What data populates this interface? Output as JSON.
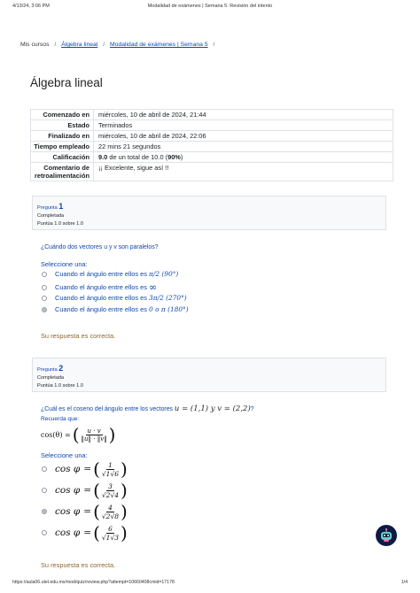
{
  "print_header": {
    "timestamp": "4/13/24, 3:06 PM",
    "title": "Modalidad de exámenes | Semana 5: Revisión del intento"
  },
  "breadcrumb": {
    "home": "Mis cursos",
    "course": "Álgebra lineal",
    "quiz": "Modalidad de exámenes | Semana 5",
    "sep": "/"
  },
  "page_title": "Álgebra lineal",
  "summary": [
    {
      "label": "Comenzado en",
      "value": "miércoles, 10 de abril de 2024, 21:44"
    },
    {
      "label": "Estado",
      "value": "Terminados"
    },
    {
      "label": "Finalizado en",
      "value": "miércoles, 10 de abril de 2024, 22:06"
    },
    {
      "label": "Tiempo empleado",
      "value": "22 mins 21 segundos"
    },
    {
      "label": "Calificación",
      "value_bold": "9.0",
      "value_mid": " de un total de 10.0 (",
      "value_pct": "90%",
      "value_end": ")"
    },
    {
      "label": "Comentario de retroalimentación",
      "value": "¡¡ Excelente, sigue así !!"
    }
  ],
  "q1": {
    "label": "Pregunta",
    "number": "1",
    "status": "Completada",
    "score": "Puntúa 1.0 sobre 1.0",
    "text": "¿Cuándo dos vectores u y v son paralelos?",
    "prompt": "Seleccione una:",
    "options": [
      {
        "pre": "Cuando el ángulo entre ellos es ",
        "math": "π/2 (90°)",
        "selected": false
      },
      {
        "pre": "Cuando el ángulo entre ellos es ",
        "math": "∞",
        "selected": false
      },
      {
        "pre": "Cuando el ángulo entre ellos es ",
        "math": "3π/2 (270°)",
        "selected": false
      },
      {
        "pre": "Cuando el ángulo entre ellos es ",
        "math": "0 o π (180°)",
        "selected": true
      }
    ],
    "feedback": "Su respuesta es correcta."
  },
  "q2": {
    "label": "Pregunta",
    "number": "2",
    "status": "Completada",
    "score": "Puntúa 1.0 sobre 1.0",
    "text": "¿Cuál es el coseno del ángulo entre los vectores ",
    "vectors": "u = (1,1)  y  v = (2,2)",
    "qmark": "?",
    "recall": "Recuerda que:",
    "formula_lhs": "cos(θ) =",
    "formula_num": "u · v",
    "formula_den": "‖u‖ · ‖v‖",
    "prompt": "Seleccione una:",
    "options": [
      {
        "cos": "cos φ",
        "eq": "=",
        "num": "1",
        "den": "√1√6",
        "selected": false
      },
      {
        "cos": "cos φ",
        "eq": "=",
        "num": "3",
        "den": "√2√4",
        "selected": false
      },
      {
        "cos": "cos φ",
        "eq": "=",
        "num": "4",
        "den": "√2√8",
        "selected": true
      },
      {
        "cos": "cos φ",
        "eq": "=",
        "num": "6",
        "den": "√1√3",
        "selected": false
      }
    ],
    "feedback": "Su respuesta es correcta."
  },
  "print_footer": {
    "url": "https://aula06.utel.edu.mx/mod/quiz/review.php?attempt=10660408cmid=17178",
    "page": "1/4"
  }
}
